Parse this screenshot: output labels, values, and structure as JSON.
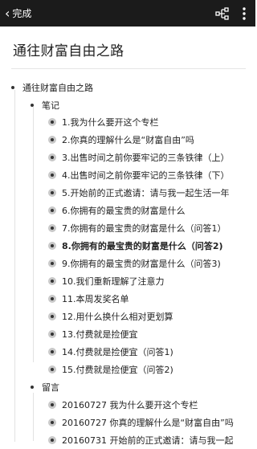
{
  "topbar": {
    "back_label": "完成",
    "tree_icon": "mindmap-tree-icon",
    "more_icon": "more-vertical-icon"
  },
  "document": {
    "title": "通往财富自由之路"
  },
  "outline": {
    "root": "通往财富自由之路",
    "sections": [
      {
        "label": "笔记",
        "items": [
          "1.我为什么要开这个专栏",
          "2.你真的理解什么是“财富自由”吗",
          "3.出售时间之前你要牢记的三条铁律（上）",
          "4.出售时间之前你要牢记的三条铁律（下）",
          "5.开始前的正式邀请：请与我一起生活一年",
          "6.你拥有的最宝贵的财富是什么",
          "7.你拥有的最宝贵的财富是什么（问答1）",
          "8.你拥有的最宝贵的财富是什么（问答2)",
          "9.你拥有的最宝贵的财富是什么（问答3)",
          "10.我们重新理解了注意力",
          "11.本周发奖名单",
          "12.用什么换什么相对更划算",
          "13.付费就是捡便宜",
          "14.付费就是捡便宜（问答1)",
          "15.付费就是捡便宜（问答2)"
        ]
      },
      {
        "label": "留言",
        "items": [
          "20160727 我为什么要开这个专栏",
          "20160727 你真的理解什么是“财富自由”吗",
          "20160731 开始前的正式邀请：请与我一起"
        ]
      }
    ]
  },
  "colors": {
    "topbar": "#1b1b1b",
    "bullet_ring": "#c8c8c8",
    "bullet_dot": "#333333"
  }
}
